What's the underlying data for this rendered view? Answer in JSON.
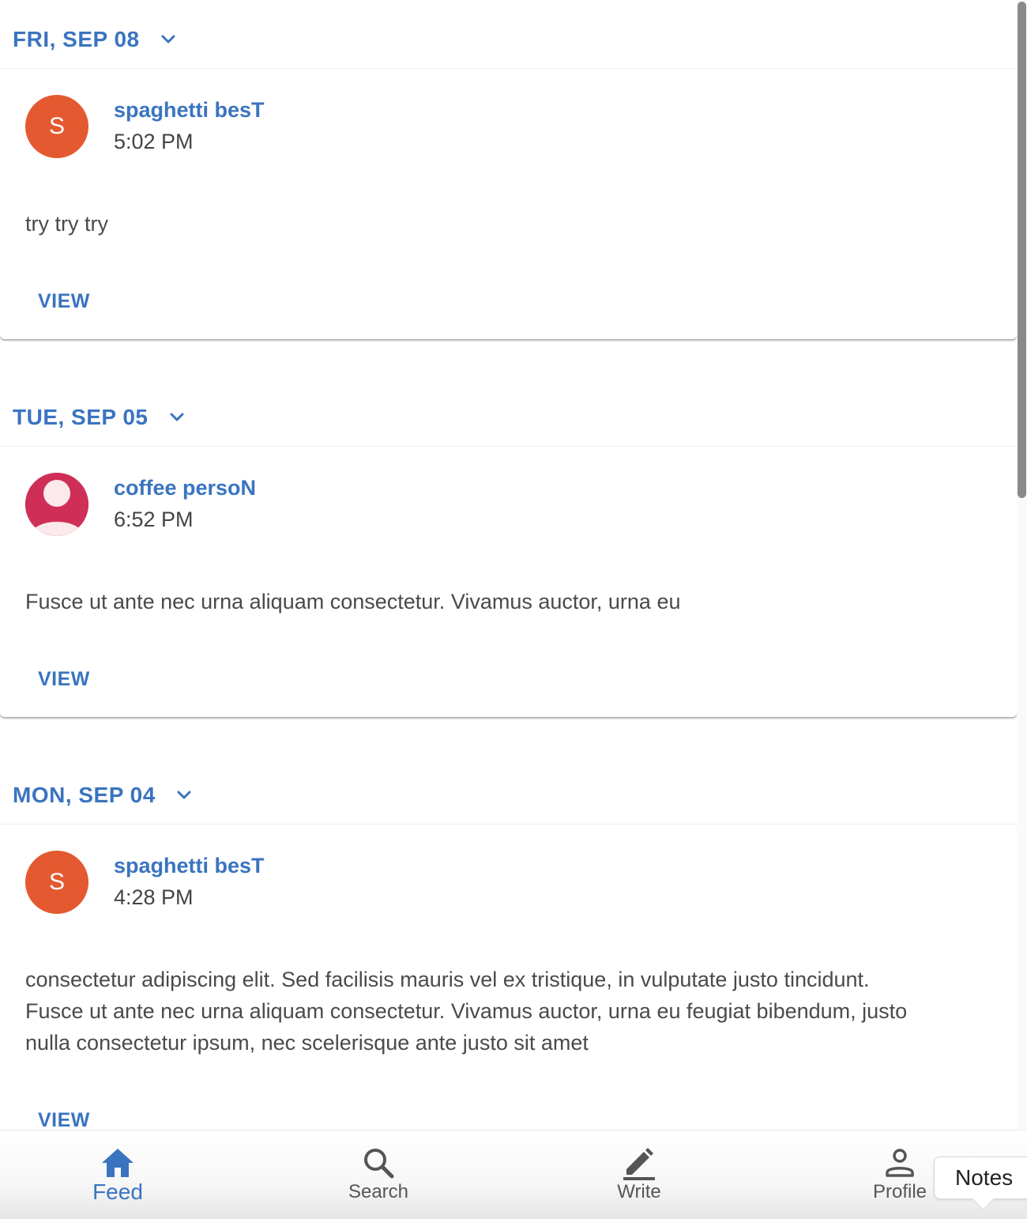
{
  "feed": {
    "sections": [
      {
        "date": "FRI, SEP 08",
        "post": {
          "avatar_letter": "S",
          "author": "spaghetti besT",
          "time": "5:02 PM",
          "body": "try try try",
          "action": "VIEW"
        }
      },
      {
        "date": "TUE, SEP 05",
        "post": {
          "avatar_letter": "",
          "author": "coffee persoN",
          "time": "6:52 PM",
          "body": "Fusce ut ante nec urna aliquam consectetur. Vivamus auctor, urna eu",
          "action": "VIEW"
        }
      },
      {
        "date": "MON, SEP 04",
        "post": {
          "avatar_letter": "S",
          "author": "spaghetti besT",
          "time": "4:28 PM",
          "body_lines": [
            "consectetur adipiscing elit. Sed facilisis mauris vel ex tristique, in vulputate justo tincidunt.",
            "Fusce ut ante nec urna aliquam consectetur. Vivamus auctor, urna eu feugiat bibendum, justo",
            "nulla consectetur ipsum, nec scelerisque ante justo sit amet"
          ],
          "action": "VIEW"
        }
      }
    ]
  },
  "bottom_nav": {
    "items": [
      {
        "label": "Feed",
        "icon": "home-icon",
        "active": true
      },
      {
        "label": "Search",
        "icon": "search-icon",
        "active": false
      },
      {
        "label": "Write",
        "icon": "pencil-icon",
        "active": false
      },
      {
        "label": "Profile",
        "icon": "person-icon",
        "active": false
      }
    ]
  },
  "tooltip": {
    "text": "Notes"
  },
  "colors": {
    "accent": "#3a74c0",
    "avatar_orange": "#e4592f",
    "avatar_crimson": "#cf2f57",
    "text": "#444444"
  }
}
